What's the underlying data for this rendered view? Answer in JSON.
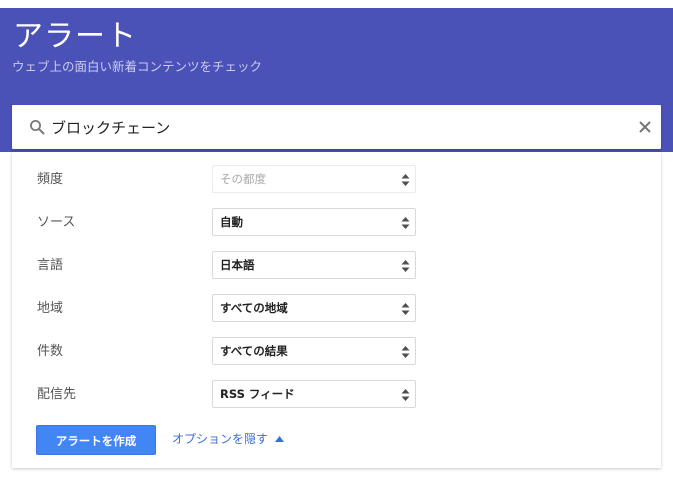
{
  "header": {
    "title": "アラート",
    "subtitle": "ウェブ上の面白い新着コンテンツをチェック"
  },
  "search": {
    "value": "ブロックチェーン",
    "search_icon": "search-icon",
    "clear_icon": "close-icon"
  },
  "options": [
    {
      "label": "頻度",
      "value": "その都度",
      "disabled": true
    },
    {
      "label": "ソース",
      "value": "自動",
      "disabled": false
    },
    {
      "label": "言語",
      "value": "日本語",
      "disabled": false
    },
    {
      "label": "地域",
      "value": "すべての地域",
      "disabled": false
    },
    {
      "label": "件数",
      "value": "すべての結果",
      "disabled": false
    },
    {
      "label": "配信先",
      "value": "RSS フィード",
      "disabled": false
    }
  ],
  "actions": {
    "create_label": "アラートを作成",
    "toggle_options_label": "オプションを隠す",
    "toggle_icon": "caret-up-icon"
  },
  "colors": {
    "header_bg": "#4a52b8",
    "primary_button": "#4285f4",
    "link": "#3b6fd3"
  }
}
